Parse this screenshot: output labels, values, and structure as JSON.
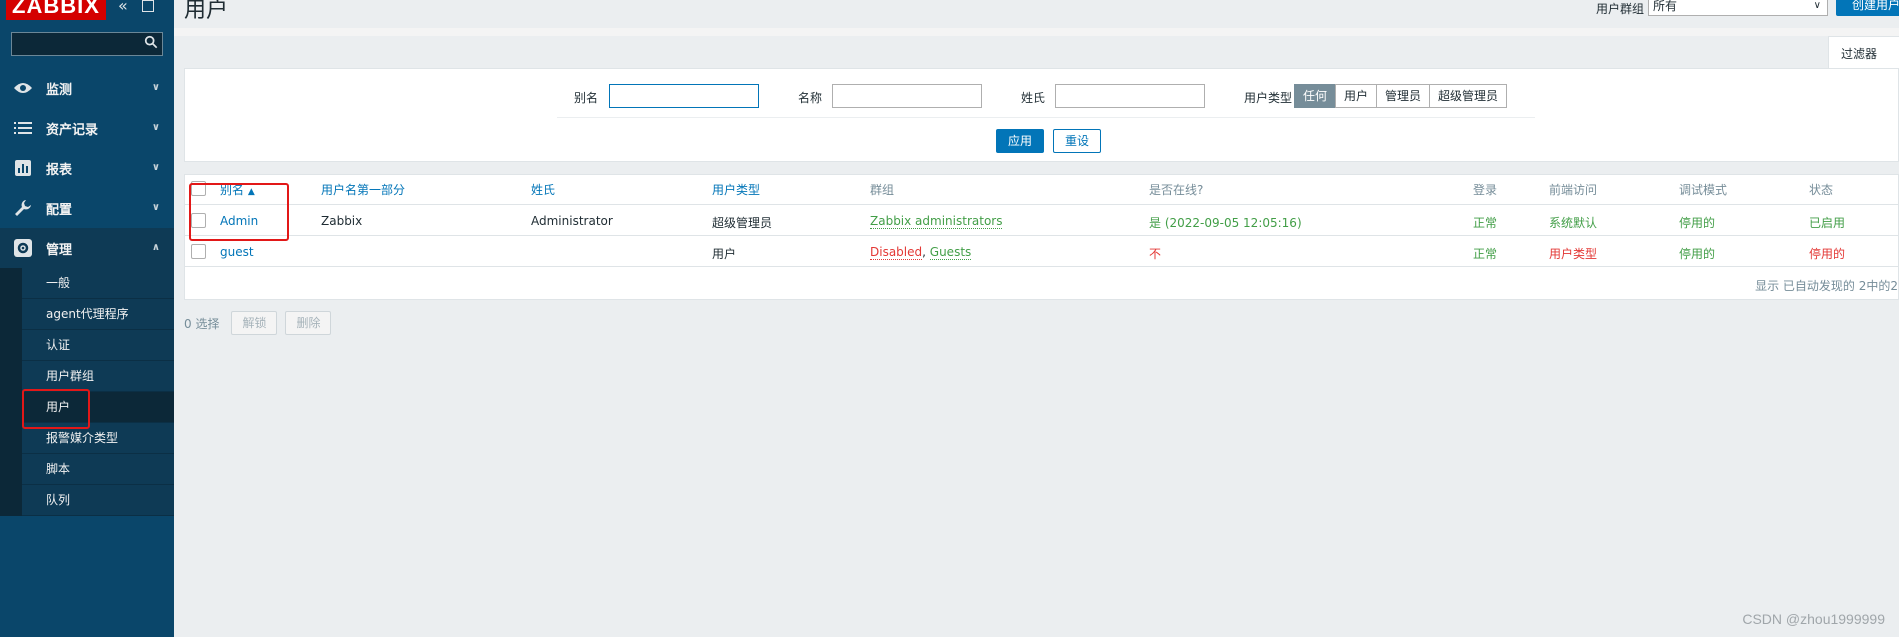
{
  "brand": {
    "logo_text": "ZABBIX"
  },
  "sidebar": {
    "search": {
      "placeholder": ""
    },
    "menu": [
      {
        "label": "监测",
        "icon": "eye-icon"
      },
      {
        "label": "资产记录",
        "icon": "list-icon"
      },
      {
        "label": "报表",
        "icon": "bar-chart-icon"
      },
      {
        "label": "配置",
        "icon": "wrench-icon"
      },
      {
        "label": "管理",
        "icon": "gear-icon"
      }
    ],
    "admin_submenu": [
      "一般",
      "agent代理程序",
      "认证",
      "用户群组",
      "用户",
      "报警媒介类型",
      "脚本",
      "队列"
    ]
  },
  "header": {
    "title": "用户",
    "group_label": "用户群组",
    "group_value": "所有",
    "create_button": "创建用户"
  },
  "filter": {
    "tab_label": "过滤器",
    "alias_label": "别名",
    "name_label": "名称",
    "surname_label": "姓氏",
    "type_label": "用户类型",
    "type_options": [
      "任何",
      "用户",
      "管理员",
      "超级管理员"
    ],
    "type_selected": "任何",
    "apply": "应用",
    "reset": "重设"
  },
  "table": {
    "headers": {
      "alias": "别名",
      "name": "用户名第一部分",
      "surname": "姓氏",
      "type": "用户类型",
      "groups": "群组",
      "online": "是否在线?",
      "login": "登录",
      "frontend": "前端访问",
      "debug": "调试模式",
      "status": "状态"
    },
    "sort_indicator": "▲",
    "rows": [
      {
        "alias": "Admin",
        "name": "Zabbix",
        "surname": "Administrator",
        "type": "超级管理员",
        "group1": "Zabbix administrators",
        "group_sep": "",
        "group2": "",
        "online": "是 (2022-09-05 12:05:16)",
        "login": "正常",
        "frontend": "系统默认",
        "debug": "停用的",
        "status": "已启用"
      },
      {
        "alias": "guest",
        "name": "",
        "surname": "",
        "type": "用户",
        "group1": "Disabled",
        "group_sep": ", ",
        "group2": "Guests",
        "online": "不",
        "login": "正常",
        "frontend": "用户类型",
        "debug": "停用的",
        "status": "停用的"
      }
    ],
    "footer": "显示 已自动发现的 2中的2"
  },
  "actions": {
    "selected": "0 选择",
    "unblock": "解锁",
    "delete": "删除"
  },
  "watermark": "CSDN @zhou1999999",
  "colors": {
    "sidebar": "#0a466a",
    "accent": "#0275b8",
    "green": "#429e47",
    "red": "#e33734",
    "highlight": "#e21818"
  }
}
